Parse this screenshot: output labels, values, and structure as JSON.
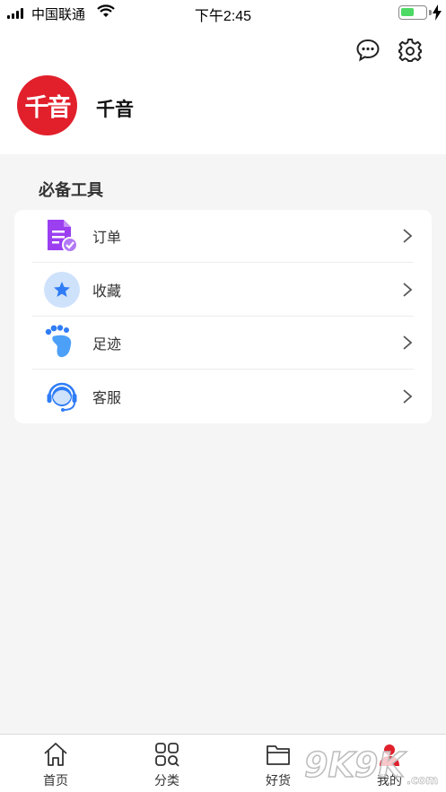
{
  "status_bar": {
    "carrier": "中国联通",
    "time": "下午2:45",
    "battery_level": 0.55
  },
  "header": {
    "message_icon": "chat-bubble-icon",
    "settings_icon": "gear-icon",
    "avatar_text": "千音",
    "username": "千音"
  },
  "tools": {
    "title": "必备工具",
    "items": [
      {
        "label": "订单",
        "icon": "order-document-icon"
      },
      {
        "label": "收藏",
        "icon": "star-icon"
      },
      {
        "label": "足迹",
        "icon": "footprint-icon"
      },
      {
        "label": "客服",
        "icon": "headset-icon"
      }
    ]
  },
  "tabbar": {
    "items": [
      {
        "label": "首页",
        "icon": "home-icon"
      },
      {
        "label": "分类",
        "icon": "grid-search-icon"
      },
      {
        "label": "好货",
        "icon": "folder-icon"
      },
      {
        "label": "我的",
        "icon": "user-icon"
      }
    ]
  },
  "watermark": {
    "text": "9K9K",
    "domain": ".com"
  },
  "colors": {
    "brand_red": "#e1202c",
    "accent_blue": "#2f7cf6",
    "order_purple": "#9b3ff0"
  }
}
